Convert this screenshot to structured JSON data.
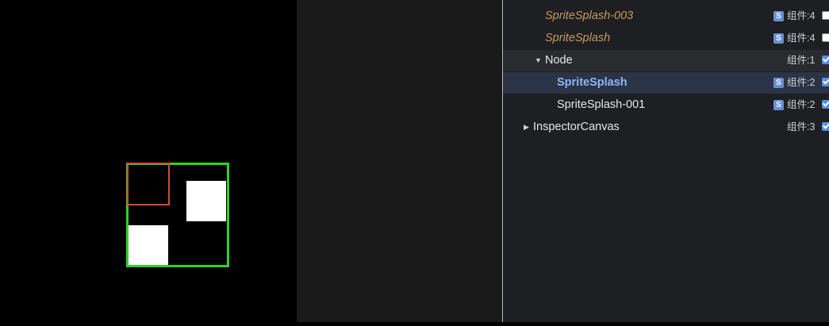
{
  "scene": {
    "colors": {
      "background": "#000000",
      "frame": "#2fd12a",
      "selection": "#d24a3a",
      "sprite": "#ffffff"
    }
  },
  "hierarchy": {
    "rows": [
      {
        "name": "SpriteSplash-003",
        "style": "prefab",
        "badge": "S",
        "components": "组件:4",
        "enabled": false
      },
      {
        "name": "SpriteSplash",
        "style": "prefab",
        "badge": "S",
        "components": "组件:4",
        "enabled": false
      },
      {
        "name": "Node",
        "style": "normal",
        "expand": "▼",
        "components": "组件:1",
        "enabled": true
      },
      {
        "name": "SpriteSplash",
        "style": "selected",
        "badge": "S",
        "components": "组件:2",
        "enabled": true
      },
      {
        "name": "SpriteSplash-001",
        "style": "normal",
        "badge": "S",
        "components": "组件:2",
        "enabled": true
      },
      {
        "name": "InspectorCanvas",
        "style": "normal",
        "expand": "▶",
        "components": "组件:3",
        "enabled": true
      }
    ]
  }
}
